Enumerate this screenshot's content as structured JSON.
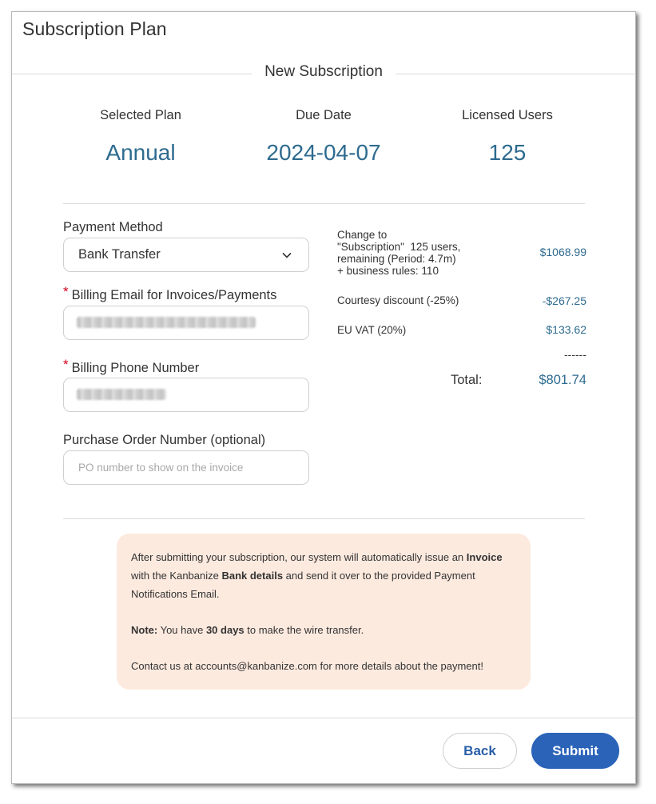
{
  "dialog": {
    "title": "Subscription Plan"
  },
  "subscription": {
    "section_title": "New Subscription",
    "stats": [
      {
        "label": "Selected Plan",
        "value": "Annual"
      },
      {
        "label": "Due Date",
        "value": "2024-04-07"
      },
      {
        "label": "Licensed Users",
        "value": "125"
      }
    ]
  },
  "form": {
    "payment_method_label": "Payment Method",
    "payment_method_value": "Bank Transfer",
    "billing_email_label": "Billing Email for Invoices/Payments",
    "billing_phone_label": "Billing Phone Number",
    "po_label": "Purchase Order Number (optional)",
    "po_placeholder": "PO number to show on the invoice",
    "required_marker": "*"
  },
  "summary": {
    "change_line1": "Change to",
    "change_line2": "\"Subscription\"  125 users,",
    "change_line3": "remaining (Period: 4.7m)",
    "change_line4": "+ business rules: 110",
    "change_value": "$1068.99",
    "discount_label": "Courtesy discount (-25%)",
    "discount_value": "-$267.25",
    "vat_label": "EU VAT (20%)",
    "vat_value": "$133.62",
    "separator": "------",
    "total_label": "Total:",
    "total_value": "$801.74"
  },
  "notice": {
    "p1_a": "After submitting your subscription, our system will automatically issue an ",
    "p1_b": "Invoice",
    "p1_c": " with the Kanbanize ",
    "p1_d": "Bank details",
    "p1_e": " and send it over to the provided Payment Notifications Email.",
    "p2_a": "Note:",
    "p2_b": " You have ",
    "p2_c": "30 days",
    "p2_d": " to make the wire transfer.",
    "p3": "Contact us at accounts@kanbanize.com for more details about the payment!"
  },
  "footer": {
    "back_label": "Back",
    "submit_label": "Submit"
  },
  "colors": {
    "accent_blue": "#2e6b8f",
    "button_blue": "#2a63b8",
    "notice_bg": "#fdeadf",
    "required_red": "#d0021b"
  }
}
